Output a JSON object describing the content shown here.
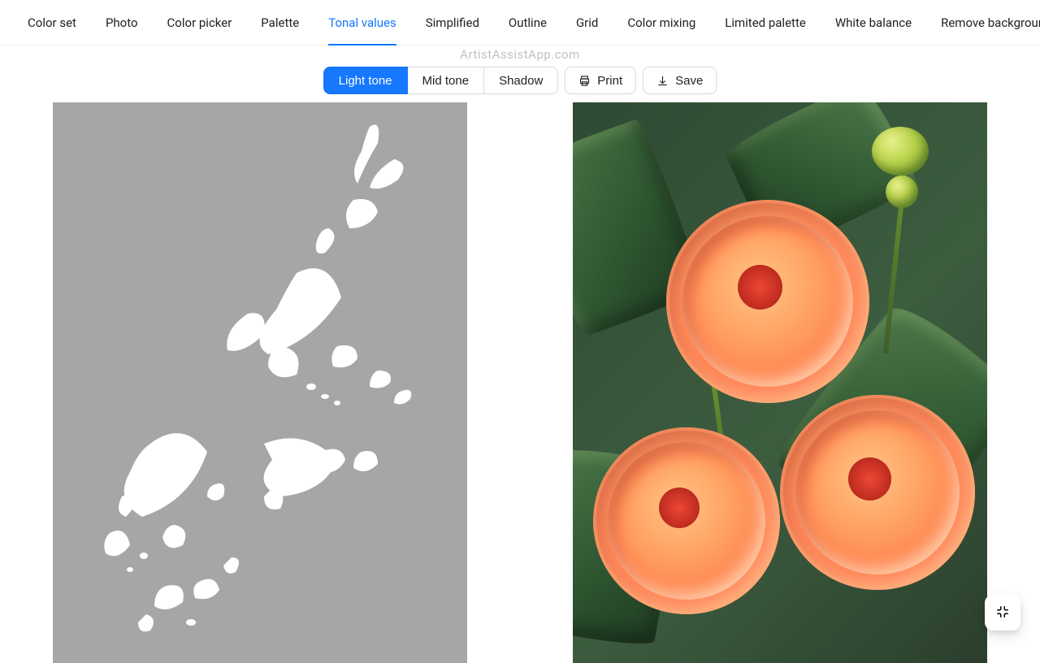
{
  "tabs": {
    "items": [
      {
        "label": "Color set"
      },
      {
        "label": "Photo"
      },
      {
        "label": "Color picker"
      },
      {
        "label": "Palette"
      },
      {
        "label": "Tonal values"
      },
      {
        "label": "Simplified"
      },
      {
        "label": "Outline"
      },
      {
        "label": "Grid"
      },
      {
        "label": "Color mixing"
      },
      {
        "label": "Limited palette"
      },
      {
        "label": "White balance"
      },
      {
        "label": "Remove background"
      }
    ],
    "active_index": 4
  },
  "watermark": "ArtistAssistApp.com",
  "tone_selector": {
    "options": [
      {
        "label": "Light tone"
      },
      {
        "label": "Mid tone"
      },
      {
        "label": "Shadow"
      }
    ],
    "selected_index": 0
  },
  "actions": {
    "print_label": "Print",
    "save_label": "Save"
  },
  "icons": {
    "print": "print-icon",
    "save": "download-icon",
    "float": "compress-icon"
  }
}
